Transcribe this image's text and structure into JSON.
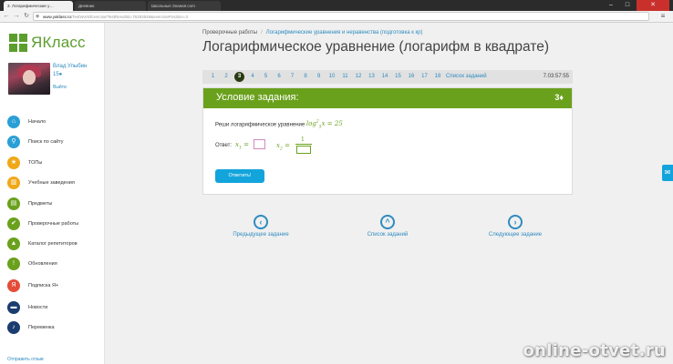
{
  "browser": {
    "tabs": [
      {
        "label": "3. Логарифмические у…"
      },
      {
        "label": "Дневник"
      },
      {
        "label": "Школьные Знания.com"
      }
    ],
    "url_host": "www.yaklass.ru",
    "url_path": "/TestWork/Exercise/TestResultId=76283548&exercisePosition=3",
    "close_glyph": "✕",
    "minimize_glyph": "–",
    "maximize_glyph": "□",
    "menu_glyph": "≡"
  },
  "sidebar": {
    "logo": "ЯКласс",
    "user": {
      "name": "Влад Улыбин",
      "points": "15●",
      "logout": "Выйти"
    },
    "items": [
      {
        "label": "Начало",
        "icon": "home-icon",
        "glyph": "⌂",
        "color": "#2a9fd6"
      },
      {
        "label": "Поиск по сайту",
        "icon": "search-icon",
        "glyph": "⚲",
        "color": "#2a9fd6"
      },
      {
        "label": "ТОПы",
        "icon": "star-icon",
        "glyph": "★",
        "color": "#f0a818"
      },
      {
        "label": "Учебные заведения",
        "icon": "school-icon",
        "glyph": "▥",
        "color": "#f0a818"
      },
      {
        "label": "Предметы",
        "icon": "book-icon",
        "glyph": "▤",
        "color": "#6aa11c"
      },
      {
        "label": "Проверочные работы",
        "icon": "check-icon",
        "glyph": "✔",
        "color": "#6aa11c"
      },
      {
        "label": "Каталог репетиторов",
        "icon": "graduation-cap-icon",
        "glyph": "▲",
        "color": "#6aa11c"
      },
      {
        "label": "Обновления",
        "icon": "exclamation-icon",
        "glyph": "!",
        "color": "#6aa11c"
      },
      {
        "label": "Подписка Я+",
        "icon": "subscription-icon",
        "glyph": "Я",
        "color": "#e34d3a"
      },
      {
        "label": "Новости",
        "icon": "news-icon",
        "glyph": "▬",
        "color": "#1b3c6e"
      },
      {
        "label": "Переменка",
        "icon": "bell-icon",
        "glyph": "♪",
        "color": "#1b3c6e"
      }
    ],
    "feedback": "Отправить отзыв"
  },
  "breadcrumb": {
    "root": "Проверочные работы",
    "separator": "/",
    "current": "Логарифмические уравнения и неравенства (подготовка к кр)"
  },
  "title": "Логарифмическое уравнение (логарифм в квадрате)",
  "pager": {
    "pages": [
      "1",
      "2",
      "3",
      "4",
      "5",
      "6",
      "7",
      "8",
      "9",
      "10",
      "11",
      "12",
      "13",
      "14",
      "15",
      "16",
      "17",
      "18"
    ],
    "current": "3",
    "list_label": "Список заданий",
    "timer": "7.03:57:55"
  },
  "task": {
    "header": "Условие задания:",
    "points": "3♦",
    "prompt": "Реши логарифмическое уравнение",
    "equation": {
      "log": "log",
      "sup": "2",
      "sub": "5",
      "var": "x",
      "rhs": "= 25"
    },
    "answer_label": "Ответ:",
    "x1_label": "x",
    "x1_sub": "1",
    "x2_label": "x",
    "x2_sub": "2",
    "eq_sign": "=",
    "frac_numerator": "1",
    "submit": "Ответить!"
  },
  "nav": {
    "prev": {
      "label": "Предыдущее задание",
      "glyph": "‹"
    },
    "list": {
      "label": "Список заданий",
      "glyph": "^"
    },
    "next": {
      "label": "Следующее задание",
      "glyph": "›"
    }
  },
  "side_tab_glyph": "✉",
  "watermark": "online-otvet.ru"
}
